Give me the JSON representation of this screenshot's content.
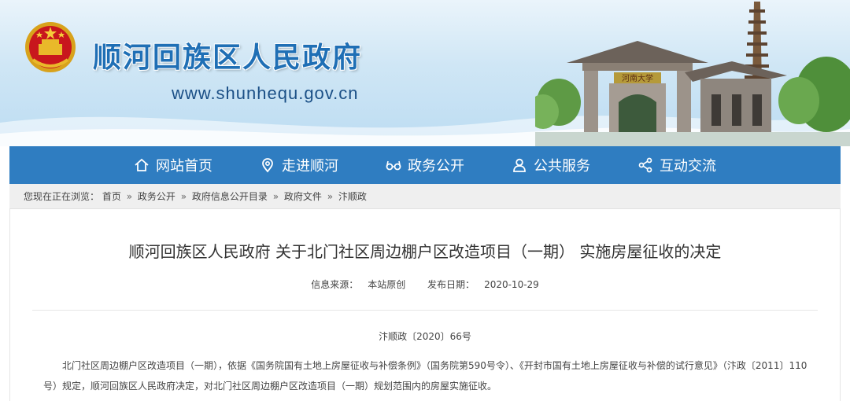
{
  "header": {
    "site_title": "顺河回族区人民政府",
    "site_url": "www.shunhequ.gov.cn",
    "gate_plaque": "河南大学",
    "emblem_icon": "national-emblem-icon"
  },
  "nav": {
    "items": [
      {
        "label": "网站首页",
        "icon": "home-icon"
      },
      {
        "label": "走进顺河",
        "icon": "location-pin-icon"
      },
      {
        "label": "政务公开",
        "icon": "glasses-icon"
      },
      {
        "label": "公共服务",
        "icon": "user-icon"
      },
      {
        "label": "互动交流",
        "icon": "share-icon"
      }
    ],
    "color": "#2f7dc1"
  },
  "breadcrumb": {
    "prefix": "您现在正在浏览：",
    "items": [
      "首页",
      "政务公开",
      "政府信息公开目录",
      "政府文件",
      "汴顺政"
    ],
    "separator": "»"
  },
  "article": {
    "title": "顺河回族区人民政府 关于北门社区周边棚户区改造项目（一期） 实施房屋征收的决定",
    "source_label": "信息来源：",
    "source_value": "本站原创",
    "date_label": "发布日期：",
    "date_value": "2020-10-29",
    "doc_number": "汴顺政〔2020〕66号",
    "paragraph": "北门社区周边棚户区改造项目（一期），依据《国务院国有土地上房屋征收与补偿条例》（国务院第590号令）、《开封市国有土地上房屋征收与补偿的试行意见》（汴政〔2011〕110号）规定，顺河回族区人民政府决定，对北门社区周边棚户区改造项目（一期）规划范围内的房屋实施征收。"
  }
}
